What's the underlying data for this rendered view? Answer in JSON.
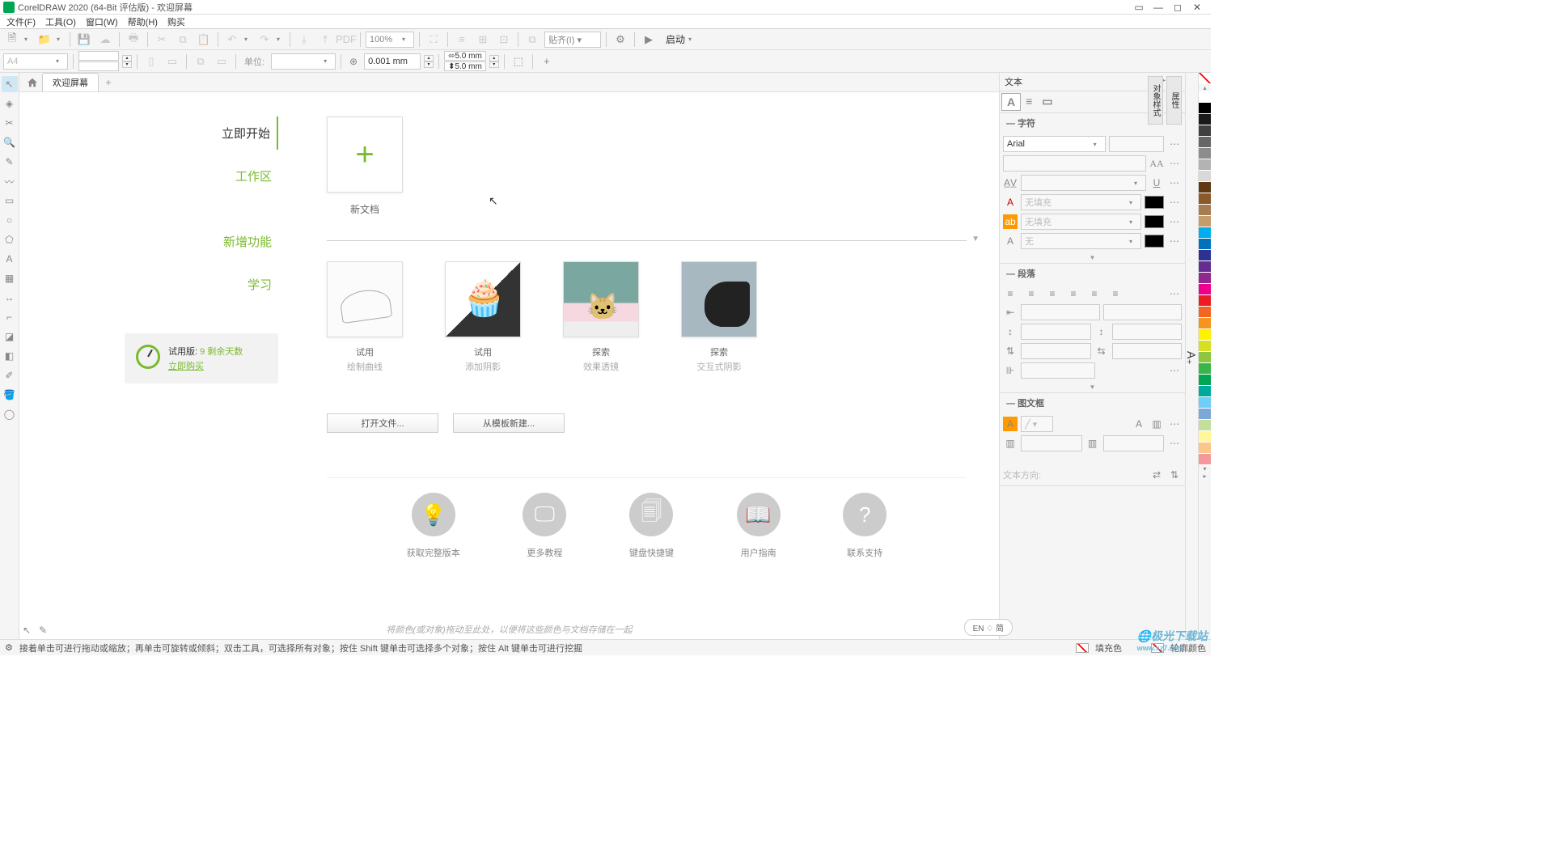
{
  "window": {
    "title": "CorelDRAW 2020 (64-Bit 评估版) - 欢迎屏幕"
  },
  "menus": [
    "文件(F)",
    "工具(O)",
    "窗口(W)",
    "帮助(H)",
    "购买"
  ],
  "toolbar1": {
    "zoom": "100%",
    "launch": "启动"
  },
  "propbar": {
    "pagesize": "A4",
    "units_label": "单位:",
    "nudge": "0.001 mm",
    "dim_w": "5.0 mm",
    "dim_h": "5.0 mm"
  },
  "tab": {
    "welcome": "欢迎屏幕"
  },
  "welcome": {
    "nav": {
      "start": "立即开始",
      "workspace": "工作区",
      "whatsnew": "新增功能",
      "learn": "学习"
    },
    "trial": {
      "label": "试用版:",
      "days": "9 剩余天数",
      "buy": "立即购买"
    },
    "newdoc": "新文档",
    "templates": [
      {
        "tag": "试用",
        "desc": "绘制曲线"
      },
      {
        "tag": "试用",
        "desc": "添加阴影"
      },
      {
        "tag": "探索",
        "desc": "效果透镜"
      },
      {
        "tag": "探索",
        "desc": "交互式阴影"
      }
    ],
    "openfile": "打开文件...",
    "fromtemplate": "从模板新建...",
    "bottomlinks": [
      "获取完整版本",
      "更多教程",
      "键盘快捷键",
      "用户指南",
      "联系支持"
    ],
    "hint": "将颜色(或对象)拖动至此处，以便将这些颜色与文档存储在一起",
    "lang": "EN ♢ 简"
  },
  "rightpanel": {
    "title": "文本",
    "sections": {
      "character": "字符",
      "paragraph": "段落",
      "frame": "图文框"
    },
    "font": "Arial",
    "nofill": "无填充",
    "none": "无",
    "textdir_label": "文本方向:"
  },
  "dockers": {
    "properties": "属性",
    "objstyle": "对象样式"
  },
  "status": {
    "hint": "接着单击可进行拖动或缩放；再单击可旋转或倾斜；双击工具，可选择所有对象；按住 Shift 键单击可选择多个对象；按住 Alt 键单击可进行挖掘",
    "fill_label": "填充色",
    "stroke_label": "轮廓颜色"
  },
  "colors": [
    "#ffffff",
    "#000000",
    "#1a1a1a",
    "#404040",
    "#666666",
    "#8c8c8c",
    "#b3b3b3",
    "#d9d9d9",
    "#603913",
    "#8b5a2b",
    "#a67c52",
    "#c69c6d",
    "#00aeef",
    "#0072bc",
    "#2e3192",
    "#662d91",
    "#92278f",
    "#ec008c",
    "#ed1c24",
    "#f26522",
    "#f7941d",
    "#fff200",
    "#d7df23",
    "#8dc63f",
    "#39b54a",
    "#00a651",
    "#00a99d",
    "#6dcff6",
    "#7da7d9",
    "#c4df9b",
    "#fff799",
    "#fdc689",
    "#f5989d"
  ]
}
